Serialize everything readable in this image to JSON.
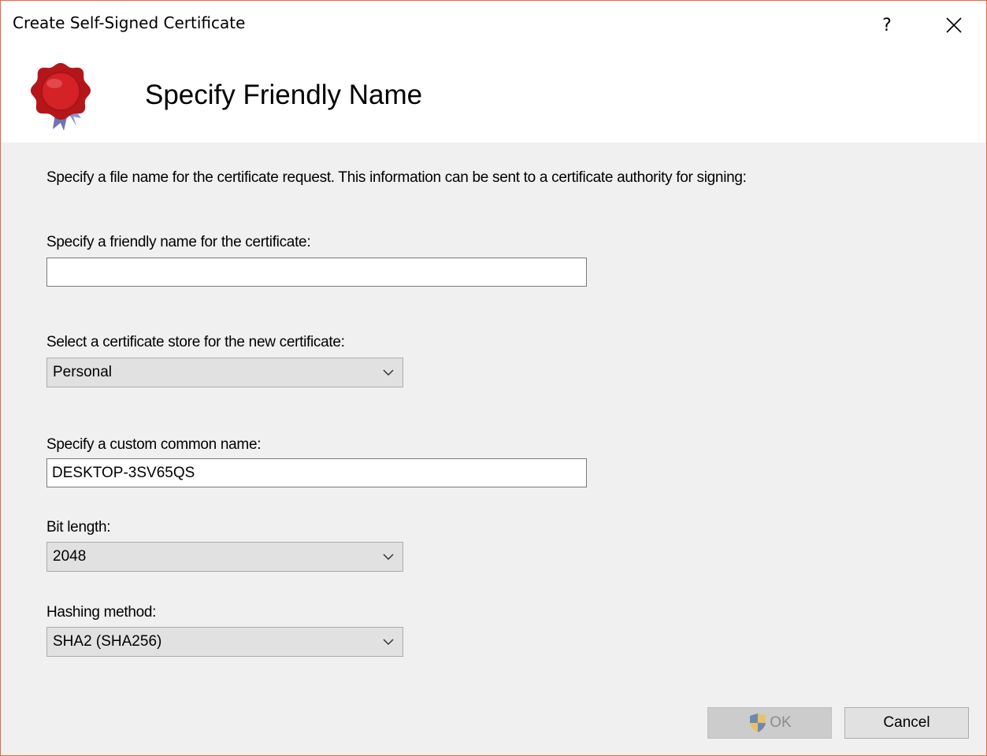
{
  "window": {
    "title": "Create Self-Signed Certificate",
    "help_label": "?",
    "close_icon": "close-icon"
  },
  "header": {
    "icon": "certificate-seal-icon",
    "title": "Specify Friendly Name"
  },
  "form": {
    "intro": "Specify a file name for the certificate request. This information can be sent to a certificate authority for signing:",
    "friendly_name": {
      "label": "Specify a friendly name for the certificate:",
      "value": ""
    },
    "store": {
      "label": "Select a certificate store for the new certificate:",
      "value": "Personal"
    },
    "common_name": {
      "label": "Specify a custom common name:",
      "value": "DESKTOP-3SV65QS"
    },
    "bit_length": {
      "label": "Bit length:",
      "value": "2048"
    },
    "hashing": {
      "label": "Hashing method:",
      "value": "SHA2 (SHA256)"
    }
  },
  "buttons": {
    "ok_label": "OK",
    "ok_icon": "uac-shield-icon",
    "cancel_label": "Cancel"
  },
  "colors": {
    "window_border": "#e8673a",
    "seal_red": "#c0171b",
    "ribbon_blue": "#7e86c8",
    "disabled_button": "#cccccc"
  }
}
